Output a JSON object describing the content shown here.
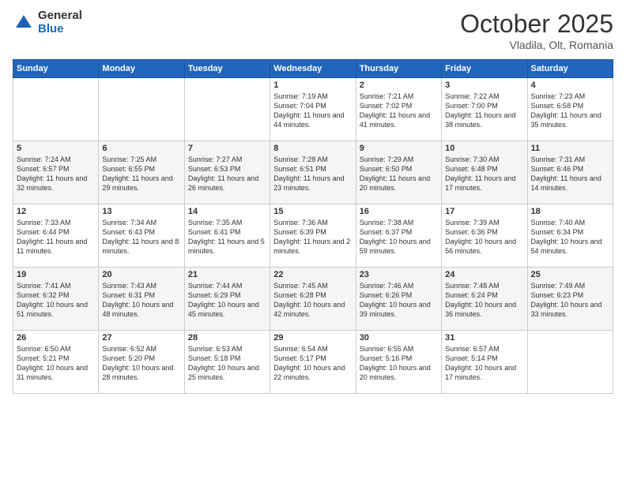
{
  "logo": {
    "general": "General",
    "blue": "Blue"
  },
  "header": {
    "month": "October 2025",
    "location": "Vladila, Olt, Romania"
  },
  "weekdays": [
    "Sunday",
    "Monday",
    "Tuesday",
    "Wednesday",
    "Thursday",
    "Friday",
    "Saturday"
  ],
  "weeks": [
    [
      {
        "day": "",
        "sunrise": "",
        "sunset": "",
        "daylight": ""
      },
      {
        "day": "",
        "sunrise": "",
        "sunset": "",
        "daylight": ""
      },
      {
        "day": "",
        "sunrise": "",
        "sunset": "",
        "daylight": ""
      },
      {
        "day": "1",
        "sunrise": "Sunrise: 7:19 AM",
        "sunset": "Sunset: 7:04 PM",
        "daylight": "Daylight: 11 hours and 44 minutes."
      },
      {
        "day": "2",
        "sunrise": "Sunrise: 7:21 AM",
        "sunset": "Sunset: 7:02 PM",
        "daylight": "Daylight: 11 hours and 41 minutes."
      },
      {
        "day": "3",
        "sunrise": "Sunrise: 7:22 AM",
        "sunset": "Sunset: 7:00 PM",
        "daylight": "Daylight: 11 hours and 38 minutes."
      },
      {
        "day": "4",
        "sunrise": "Sunrise: 7:23 AM",
        "sunset": "Sunset: 6:58 PM",
        "daylight": "Daylight: 11 hours and 35 minutes."
      }
    ],
    [
      {
        "day": "5",
        "sunrise": "Sunrise: 7:24 AM",
        "sunset": "Sunset: 6:57 PM",
        "daylight": "Daylight: 11 hours and 32 minutes."
      },
      {
        "day": "6",
        "sunrise": "Sunrise: 7:25 AM",
        "sunset": "Sunset: 6:55 PM",
        "daylight": "Daylight: 11 hours and 29 minutes."
      },
      {
        "day": "7",
        "sunrise": "Sunrise: 7:27 AM",
        "sunset": "Sunset: 6:53 PM",
        "daylight": "Daylight: 11 hours and 26 minutes."
      },
      {
        "day": "8",
        "sunrise": "Sunrise: 7:28 AM",
        "sunset": "Sunset: 6:51 PM",
        "daylight": "Daylight: 11 hours and 23 minutes."
      },
      {
        "day": "9",
        "sunrise": "Sunrise: 7:29 AM",
        "sunset": "Sunset: 6:50 PM",
        "daylight": "Daylight: 11 hours and 20 minutes."
      },
      {
        "day": "10",
        "sunrise": "Sunrise: 7:30 AM",
        "sunset": "Sunset: 6:48 PM",
        "daylight": "Daylight: 11 hours and 17 minutes."
      },
      {
        "day": "11",
        "sunrise": "Sunrise: 7:31 AM",
        "sunset": "Sunset: 6:46 PM",
        "daylight": "Daylight: 11 hours and 14 minutes."
      }
    ],
    [
      {
        "day": "12",
        "sunrise": "Sunrise: 7:33 AM",
        "sunset": "Sunset: 6:44 PM",
        "daylight": "Daylight: 11 hours and 11 minutes."
      },
      {
        "day": "13",
        "sunrise": "Sunrise: 7:34 AM",
        "sunset": "Sunset: 6:43 PM",
        "daylight": "Daylight: 11 hours and 8 minutes."
      },
      {
        "day": "14",
        "sunrise": "Sunrise: 7:35 AM",
        "sunset": "Sunset: 6:41 PM",
        "daylight": "Daylight: 11 hours and 5 minutes."
      },
      {
        "day": "15",
        "sunrise": "Sunrise: 7:36 AM",
        "sunset": "Sunset: 6:39 PM",
        "daylight": "Daylight: 11 hours and 2 minutes."
      },
      {
        "day": "16",
        "sunrise": "Sunrise: 7:38 AM",
        "sunset": "Sunset: 6:37 PM",
        "daylight": "Daylight: 10 hours and 59 minutes."
      },
      {
        "day": "17",
        "sunrise": "Sunrise: 7:39 AM",
        "sunset": "Sunset: 6:36 PM",
        "daylight": "Daylight: 10 hours and 56 minutes."
      },
      {
        "day": "18",
        "sunrise": "Sunrise: 7:40 AM",
        "sunset": "Sunset: 6:34 PM",
        "daylight": "Daylight: 10 hours and 54 minutes."
      }
    ],
    [
      {
        "day": "19",
        "sunrise": "Sunrise: 7:41 AM",
        "sunset": "Sunset: 6:32 PM",
        "daylight": "Daylight: 10 hours and 51 minutes."
      },
      {
        "day": "20",
        "sunrise": "Sunrise: 7:43 AM",
        "sunset": "Sunset: 6:31 PM",
        "daylight": "Daylight: 10 hours and 48 minutes."
      },
      {
        "day": "21",
        "sunrise": "Sunrise: 7:44 AM",
        "sunset": "Sunset: 6:29 PM",
        "daylight": "Daylight: 10 hours and 45 minutes."
      },
      {
        "day": "22",
        "sunrise": "Sunrise: 7:45 AM",
        "sunset": "Sunset: 6:28 PM",
        "daylight": "Daylight: 10 hours and 42 minutes."
      },
      {
        "day": "23",
        "sunrise": "Sunrise: 7:46 AM",
        "sunset": "Sunset: 6:26 PM",
        "daylight": "Daylight: 10 hours and 39 minutes."
      },
      {
        "day": "24",
        "sunrise": "Sunrise: 7:48 AM",
        "sunset": "Sunset: 6:24 PM",
        "daylight": "Daylight: 10 hours and 36 minutes."
      },
      {
        "day": "25",
        "sunrise": "Sunrise: 7:49 AM",
        "sunset": "Sunset: 6:23 PM",
        "daylight": "Daylight: 10 hours and 33 minutes."
      }
    ],
    [
      {
        "day": "26",
        "sunrise": "Sunrise: 6:50 AM",
        "sunset": "Sunset: 5:21 PM",
        "daylight": "Daylight: 10 hours and 31 minutes."
      },
      {
        "day": "27",
        "sunrise": "Sunrise: 6:52 AM",
        "sunset": "Sunset: 5:20 PM",
        "daylight": "Daylight: 10 hours and 28 minutes."
      },
      {
        "day": "28",
        "sunrise": "Sunrise: 6:53 AM",
        "sunset": "Sunset: 5:18 PM",
        "daylight": "Daylight: 10 hours and 25 minutes."
      },
      {
        "day": "29",
        "sunrise": "Sunrise: 6:54 AM",
        "sunset": "Sunset: 5:17 PM",
        "daylight": "Daylight: 10 hours and 22 minutes."
      },
      {
        "day": "30",
        "sunrise": "Sunrise: 6:55 AM",
        "sunset": "Sunset: 5:16 PM",
        "daylight": "Daylight: 10 hours and 20 minutes."
      },
      {
        "day": "31",
        "sunrise": "Sunrise: 6:57 AM",
        "sunset": "Sunset: 5:14 PM",
        "daylight": "Daylight: 10 hours and 17 minutes."
      },
      {
        "day": "",
        "sunrise": "",
        "sunset": "",
        "daylight": ""
      }
    ]
  ]
}
